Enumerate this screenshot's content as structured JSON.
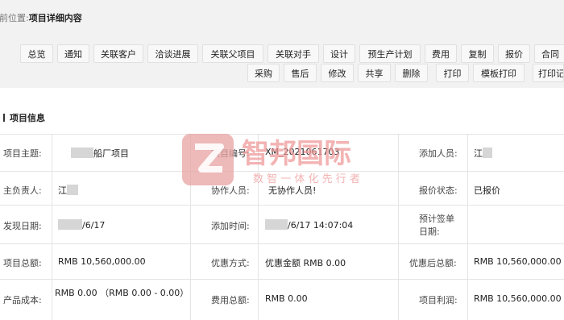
{
  "breadcrumb": {
    "prefix": "前位置:",
    "current": "项目详细内容"
  },
  "toolbar": {
    "row1": [
      "总览",
      "通知",
      "关联客户",
      "洽谈进展",
      "关联父项目",
      "关联对手",
      "设计",
      "预生产计划",
      "费用",
      "复制",
      "报价",
      "合同"
    ],
    "row2": [
      "采购",
      "售后",
      "修改",
      "共享",
      "删除",
      "打印",
      "模板打印",
      "打印记"
    ]
  },
  "section": {
    "title": "项目信息"
  },
  "fields": {
    "subject": {
      "label": "项目主题:",
      "value": "船厂项目"
    },
    "code": {
      "label": "项目编号:",
      "value": "XM_2021061703"
    },
    "adder": {
      "label": "添加人员:",
      "value": "江"
    },
    "owner": {
      "label": "主负责人:",
      "value": "江"
    },
    "collab": {
      "label": "协作人员:",
      "value": "无协作人员!"
    },
    "quote_status": {
      "label": "报价状态:",
      "value": "已报价"
    },
    "found_date": {
      "label": "发现日期:",
      "value": "/6/17"
    },
    "add_time": {
      "label": "添加时间:",
      "value": "/6/17 14:07:04"
    },
    "expected_sign": {
      "label": "预计签单日期:",
      "value": ""
    },
    "total": {
      "label": "项目总额:",
      "value": "RMB 10,560,000.00"
    },
    "discount": {
      "label": "优惠方式:",
      "value": "优惠金额 RMB 0.00"
    },
    "after_discount": {
      "label": "优惠后总额:",
      "value": "RMB 10,560,000.00"
    },
    "cost": {
      "label": "产品成本:",
      "value": "RMB 0.00 （RMB 0.00 - 0.00）"
    },
    "expense": {
      "label": "费用总额:",
      "value": "RMB 0.00"
    },
    "profit": {
      "label": "项目利润:",
      "value": "RMB 10,560,000.00"
    }
  },
  "watermark": {
    "brand": "智邦国际",
    "slogan": "数 智 一 体 化 先 行 者",
    "colors": {
      "mark": "#e8a1a1",
      "text": "#ef9a9a"
    }
  }
}
